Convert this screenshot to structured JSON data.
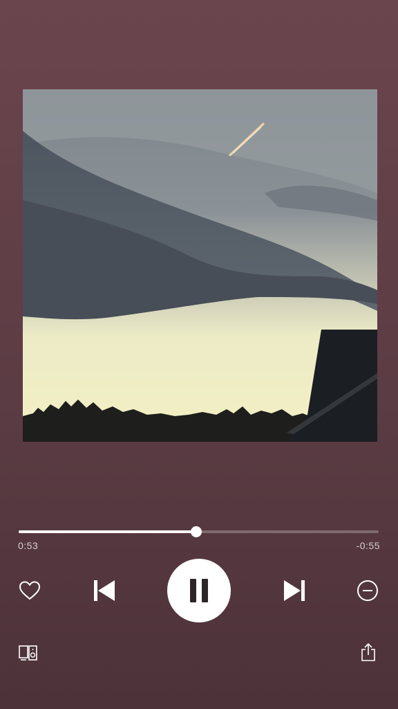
{
  "player": {
    "elapsed": "0:53",
    "remaining": "-0:55",
    "progress_fraction": 0.494,
    "is_playing": true
  },
  "controls": {
    "like": "heart-icon",
    "previous": "skip-previous-icon",
    "play_pause": "pause-icon",
    "next": "skip-next-icon",
    "hide": "minus-circle-icon",
    "devices": "devices-icon",
    "share": "share-icon"
  },
  "colors": {
    "background": "#5c3c44",
    "accent": "#ffffff",
    "track": "rgba(255,255,255,0.25)"
  }
}
